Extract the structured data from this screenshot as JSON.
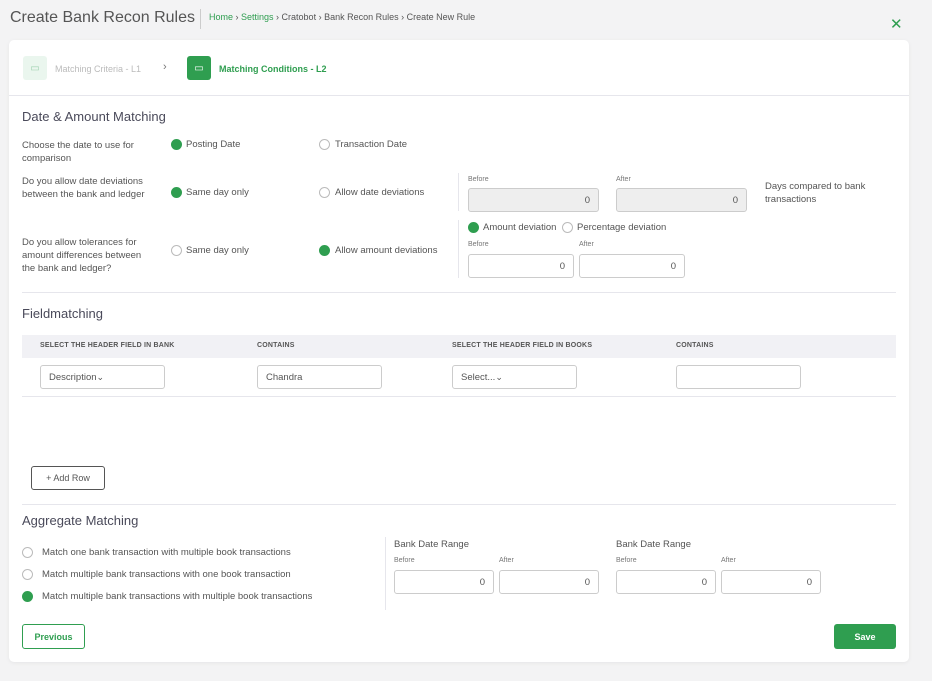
{
  "header": {
    "title": "Create Bank Recon Rules",
    "breadcrumb": [
      "Home",
      "Settings",
      "Cratobot",
      "Bank Recon Rules",
      "Create New Rule"
    ],
    "close_icon": "close-x"
  },
  "colors": {
    "accent": "#2f9e50"
  },
  "steps": [
    {
      "label": "Matching Criteria - L1",
      "active": false
    },
    {
      "label": "Matching Conditions - L2",
      "active": true
    }
  ],
  "date_amount": {
    "title": "Date & Amount Matching",
    "q1": {
      "label": "Choose the date to use for comparison",
      "options": [
        "Posting Date",
        "Transaction Date"
      ],
      "selected": 0
    },
    "q2": {
      "label": "Do you allow date deviations between the bank and ledger",
      "options": [
        "Same day only",
        "Allow date deviations"
      ],
      "selected": 0,
      "before_label": "Before",
      "after_label": "After",
      "before": "0",
      "after": "0",
      "note": "Days compared to bank transactions"
    },
    "q3": {
      "label": "Do you allow tolerances for amount differences between the bank and ledger?",
      "options": [
        "Same day only",
        "Allow amount deviations"
      ],
      "selected": 1,
      "deviation_types": [
        "Amount deviation",
        "Percentage deviation"
      ],
      "deviation_selected": 0,
      "before_label": "Before",
      "after_label": "After",
      "before": "0",
      "after": "0"
    }
  },
  "fieldmatching": {
    "title": "Fieldmatching",
    "columns": [
      "SELECT THE HEADER FIELD IN BANK",
      "CONTAINS",
      "SELECT THE HEADER FIELD IN BOOKS",
      "CONTAINS"
    ],
    "rows": [
      {
        "bank_field": "Description",
        "bank_contains": "Chandra",
        "books_field": "Select...",
        "books_contains": ""
      }
    ],
    "add_row": "+ Add Row"
  },
  "aggregate": {
    "title": "Aggregate Matching",
    "options": [
      "Match one bank transaction with multiple book transactions",
      "Match multiple bank transactions with one book transaction",
      "Match multiple bank transactions with multiple book transactions"
    ],
    "selected": 2,
    "ranges": [
      {
        "label": "Bank Date Range",
        "before_label": "Before",
        "after_label": "After",
        "before": "0",
        "after": "0"
      },
      {
        "label": "Bank Date Range",
        "before_label": "Before",
        "after_label": "After",
        "before": "0",
        "after": "0"
      }
    ]
  },
  "footer": {
    "previous": "Previous",
    "save": "Save"
  }
}
